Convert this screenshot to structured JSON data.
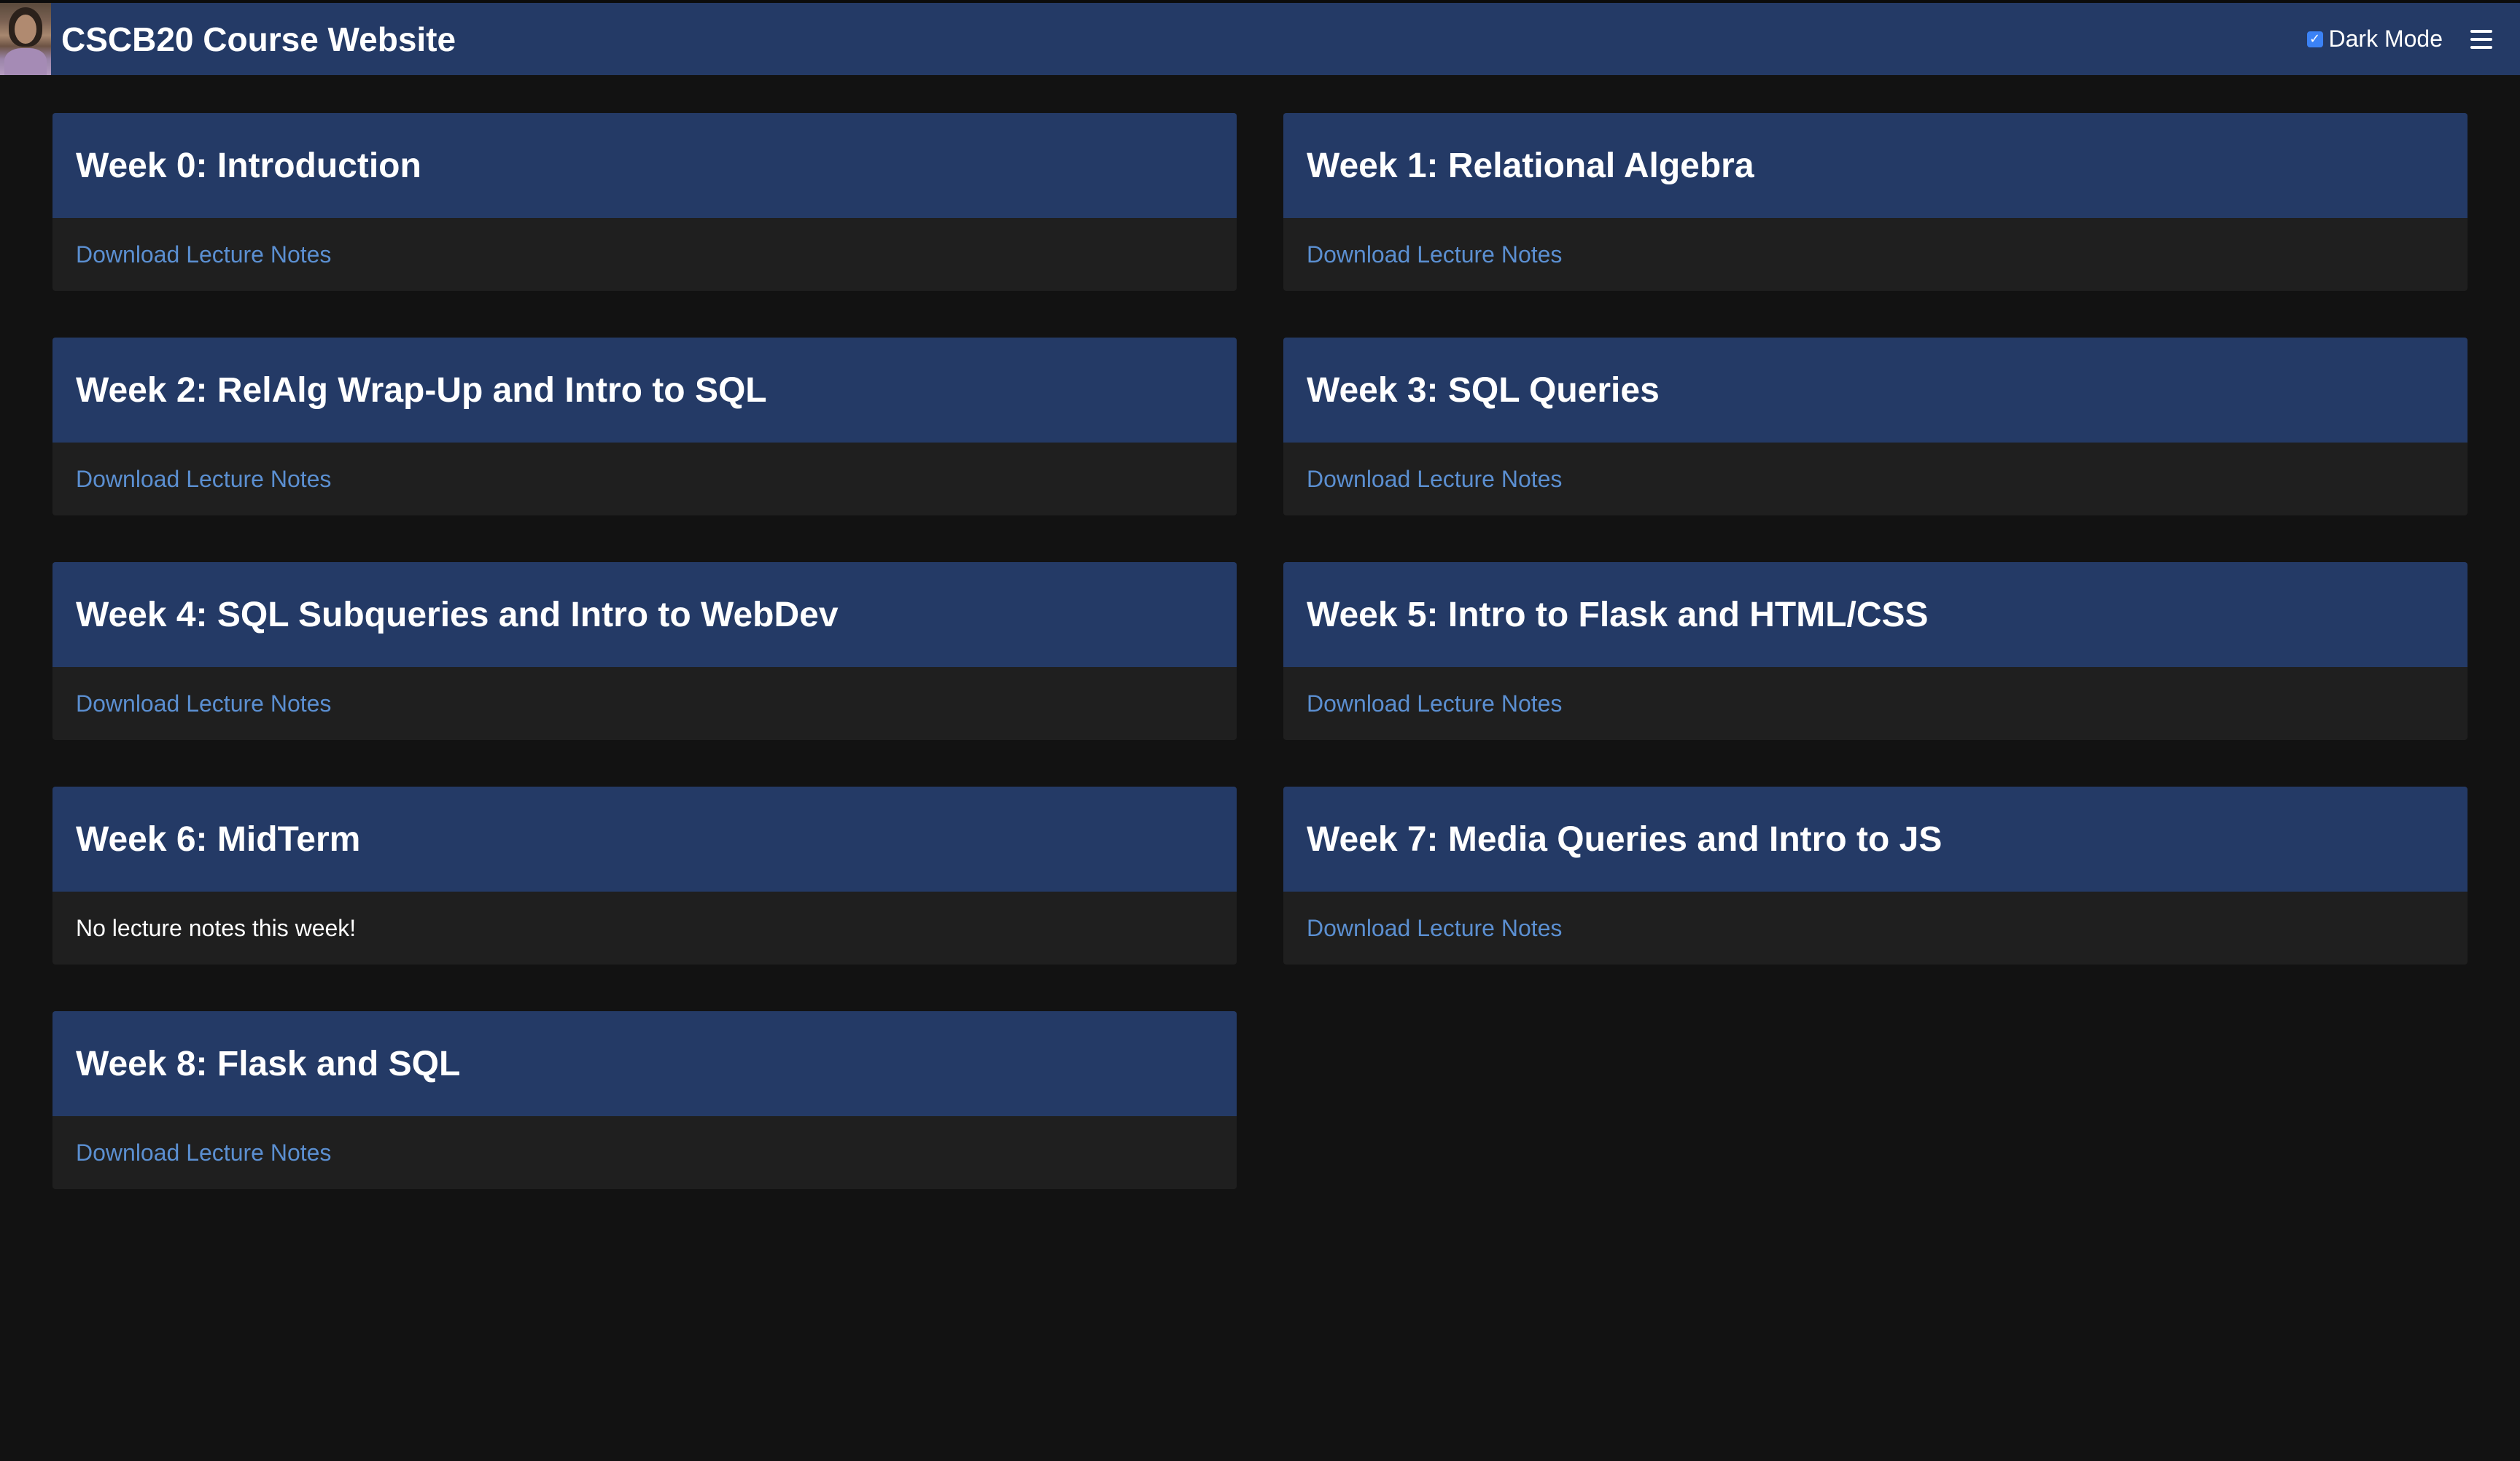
{
  "header": {
    "title": "CSCB20 Course Website",
    "dark_mode_label": "Dark Mode",
    "dark_mode_checked": true
  },
  "weeks": [
    {
      "title": "Week 0: Introduction",
      "link": "Download Lecture Notes"
    },
    {
      "title": "Week 1: Relational Algebra",
      "link": "Download Lecture Notes"
    },
    {
      "title": "Week 2: RelAlg Wrap-Up and Intro to SQL",
      "link": "Download Lecture Notes"
    },
    {
      "title": "Week 3: SQL Queries",
      "link": "Download Lecture Notes"
    },
    {
      "title": "Week 4: SQL Subqueries and Intro to WebDev",
      "link": "Download Lecture Notes"
    },
    {
      "title": "Week 5: Intro to Flask and HTML/CSS",
      "link": "Download Lecture Notes"
    },
    {
      "title": "Week 6: MidTerm",
      "text": "No lecture notes this week!"
    },
    {
      "title": "Week 7: Media Queries and Intro to JS",
      "link": "Download Lecture Notes"
    },
    {
      "title": "Week 8: Flask and SQL",
      "link": "Download Lecture Notes"
    }
  ]
}
